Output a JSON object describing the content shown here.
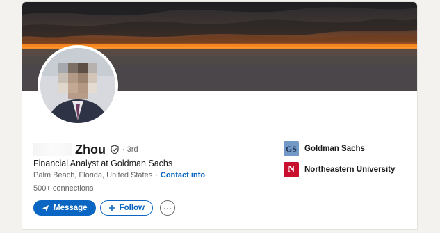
{
  "profile": {
    "name": "Zhou",
    "degree": "· 3rd",
    "headline": "Financial Analyst at Goldman Sachs",
    "location": "Palm Beach, Florida, United States",
    "contact_sep": "·",
    "contact_label": "Contact info",
    "connections": "500+ connections"
  },
  "actions": {
    "message_label": "Message",
    "follow_label": "Follow",
    "more_symbol": "···"
  },
  "organizations": [
    {
      "name": "Goldman Sachs",
      "logo_text": "GS",
      "logo_color": "#7399c6"
    },
    {
      "name": "Northeastern University",
      "logo_text": "N",
      "logo_color": "#c8102e"
    }
  ],
  "colors": {
    "accent": "#0a66c2",
    "text_secondary": "#666666"
  },
  "icons": {
    "verified": "verified-shield-icon",
    "message": "send-icon",
    "follow": "plus-icon",
    "more": "more-horizontal-icon"
  }
}
